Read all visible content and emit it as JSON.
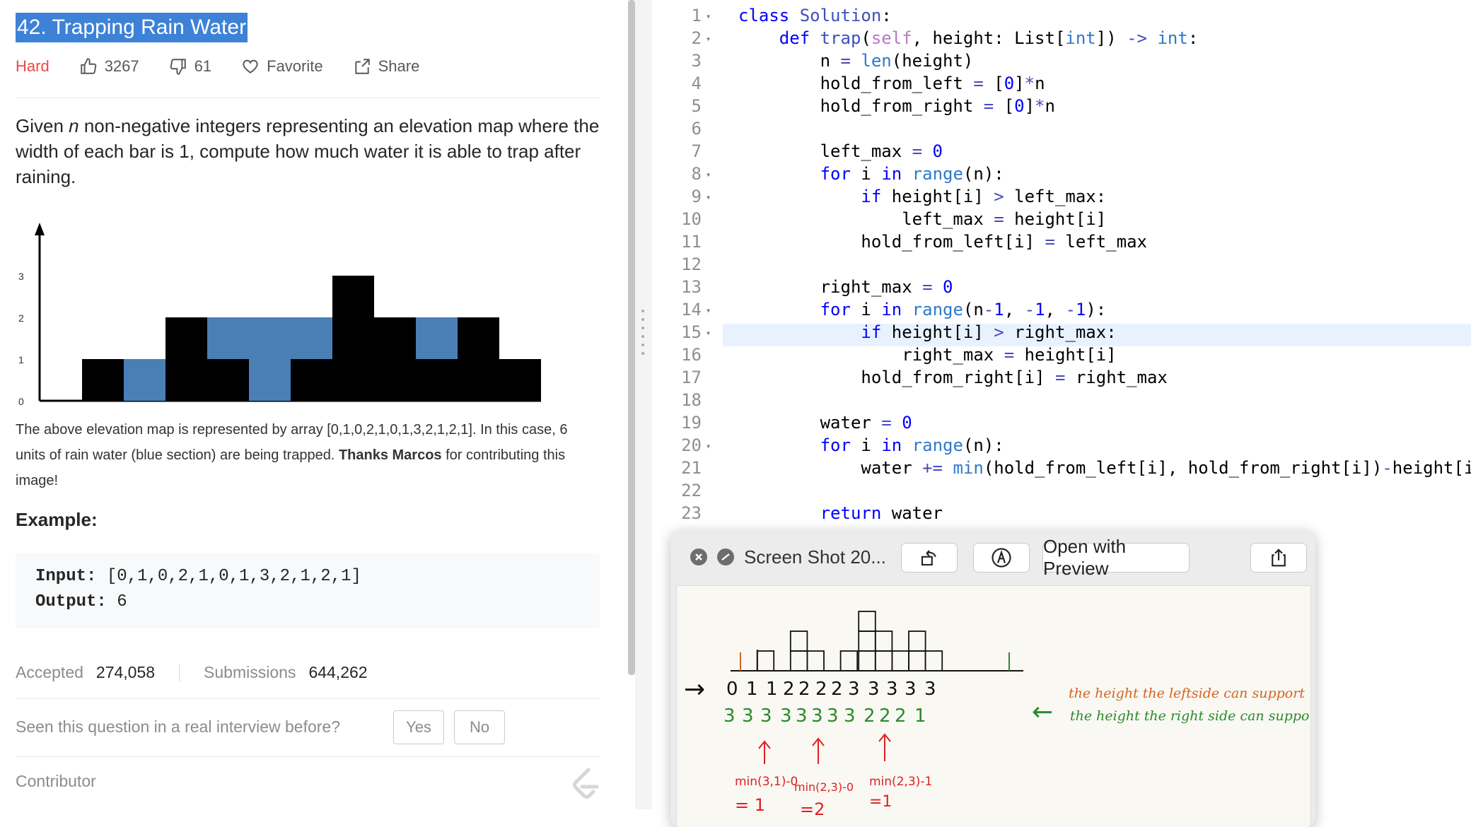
{
  "problem": {
    "title": "42. Trapping Rain Water",
    "difficulty": "Hard",
    "likes": "3267",
    "dislikes": "61",
    "favorite_label": "Favorite",
    "share_label": "Share",
    "description_1": "Given ",
    "description_n": "n",
    "description_2": " non-negative integers representing an elevation map where the width of each bar is 1, compute how much water it is able to trap after raining.",
    "caption_1": "The above elevation map is represented by array [0,1,0,2,1,0,1,3,2,1,2,1]. In this case, 6 units of rain water (blue section) are being trapped. ",
    "caption_bold": "Thanks Marcos",
    "caption_2": " for contributing this image!",
    "example_title": "Example:",
    "input_label": "Input:",
    "input_value": " [0,1,0,2,1,0,1,3,2,1,2,1]",
    "output_label": "Output:",
    "output_value": " 6",
    "accepted_label": "Accepted",
    "accepted_value": "274,058",
    "submissions_label": "Submissions",
    "submissions_value": "644,262",
    "interview_question": "Seen this question in a real interview before?",
    "yes_label": "Yes",
    "no_label": "No",
    "contributor_label": "Contributor"
  },
  "elevation_map": {
    "heights": [
      0,
      1,
      0,
      2,
      1,
      0,
      1,
      3,
      2,
      1,
      2,
      1
    ],
    "water": [
      0,
      0,
      1,
      0,
      1,
      2,
      1,
      0,
      0,
      1,
      0,
      0
    ],
    "y_ticks": [
      "0",
      "1",
      "2",
      "3"
    ],
    "bar_color": "#000000",
    "water_color": "#4a7fb5"
  },
  "editor": {
    "lines": [
      {
        "n": "1",
        "fold": true
      },
      {
        "n": "2",
        "fold": true
      },
      {
        "n": "3"
      },
      {
        "n": "4"
      },
      {
        "n": "5"
      },
      {
        "n": "6"
      },
      {
        "n": "7"
      },
      {
        "n": "8",
        "fold": true
      },
      {
        "n": "9",
        "fold": true
      },
      {
        "n": "10"
      },
      {
        "n": "11"
      },
      {
        "n": "12"
      },
      {
        "n": "13"
      },
      {
        "n": "14",
        "fold": true
      },
      {
        "n": "15",
        "fold": true
      },
      {
        "n": "16"
      },
      {
        "n": "17"
      },
      {
        "n": "18"
      },
      {
        "n": "19"
      },
      {
        "n": "20",
        "fold": true
      },
      {
        "n": "21"
      },
      {
        "n": "22"
      },
      {
        "n": "23"
      }
    ],
    "highlighted_line": "15"
  },
  "quicklook": {
    "title": "Screen Shot 20...",
    "open_with": "Open with Preview",
    "top_row": [
      "0",
      "1",
      "1",
      "2",
      "2",
      "2",
      "2",
      "3",
      "3",
      "3",
      "3",
      "3"
    ],
    "bottom_row": [
      "3",
      "3",
      "3",
      "3",
      "3",
      "3",
      "3",
      "3",
      "2",
      "2",
      "2",
      "1"
    ],
    "note_left": "the height the leftside can support .",
    "note_right": "the height the right side can support .",
    "calc_1": "min(3,1)-0",
    "calc_1_res": "= 1",
    "calc_2": "min(2,3)-0",
    "calc_2_res": "=2",
    "calc_3": "min(2,3)-1",
    "calc_3_res": "=1",
    "left_arrow": "→",
    "right_arrow": "←"
  }
}
